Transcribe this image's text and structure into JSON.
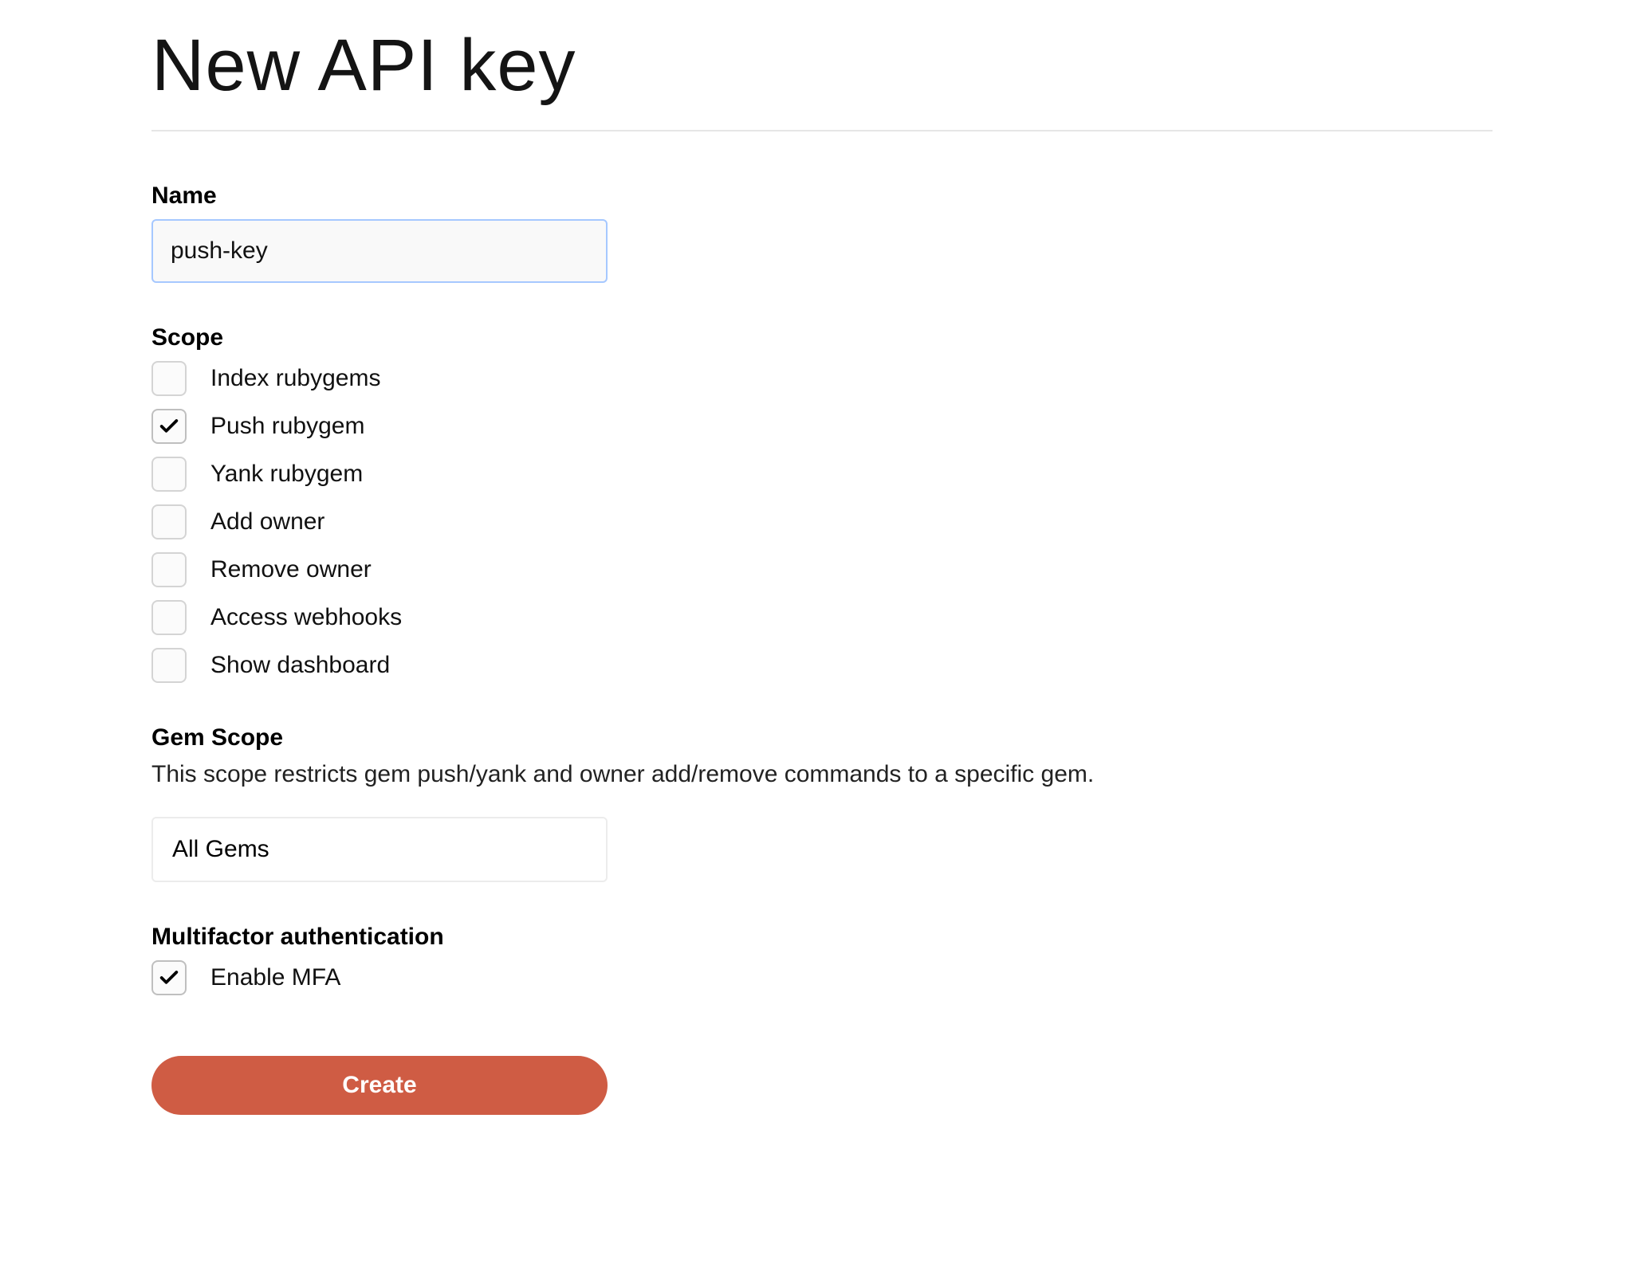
{
  "page": {
    "title": "New API key"
  },
  "name_section": {
    "label": "Name",
    "value": "push-key"
  },
  "scope_section": {
    "label": "Scope",
    "items": [
      {
        "label": "Index rubygems",
        "checked": false
      },
      {
        "label": "Push rubygem",
        "checked": true
      },
      {
        "label": "Yank rubygem",
        "checked": false
      },
      {
        "label": "Add owner",
        "checked": false
      },
      {
        "label": "Remove owner",
        "checked": false
      },
      {
        "label": "Access webhooks",
        "checked": false
      },
      {
        "label": "Show dashboard",
        "checked": false
      }
    ]
  },
  "gem_scope_section": {
    "label": "Gem Scope",
    "help": "This scope restricts gem push/yank and owner add/remove commands to a specific gem.",
    "selected": "All Gems"
  },
  "mfa_section": {
    "label": "Multifactor authentication",
    "option_label": "Enable MFA",
    "checked": true
  },
  "actions": {
    "create_label": "Create"
  }
}
